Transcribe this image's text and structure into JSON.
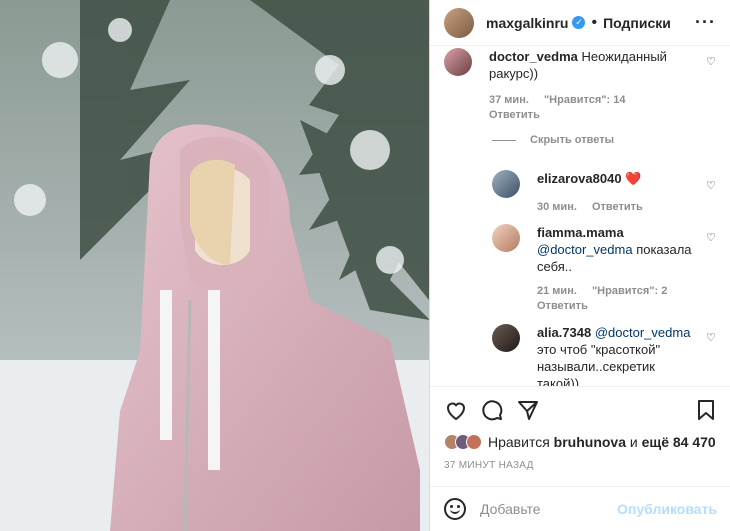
{
  "header": {
    "username": "maxgalkinru",
    "verified_icon": "verified-badge-icon",
    "separator": "•",
    "follow_label": "Подписки",
    "more_icon": "more-options-icon"
  },
  "comments": [
    {
      "user": "doctor_vedma",
      "text": "Неожиданный ракурс))",
      "time": "37 мин.",
      "likes": "\"Нравится\": 14",
      "reply": "Ответить"
    },
    {
      "hide_replies": "Скрыть ответы"
    },
    {
      "user": "elizarova8040",
      "text": "❤️",
      "time": "30 мин.",
      "reply": "Ответить"
    },
    {
      "user": "fiamma.mama",
      "mention": "@doctor_vedma",
      "text": " показала себя..",
      "time": "21 мин.",
      "likes": "\"Нравится\": 2",
      "reply": "Ответить"
    },
    {
      "user": "alia.7348",
      "mention": "@doctor_vedma",
      "text": " это чтоб \"красоткой\" называли..секретик такой))"
    }
  ],
  "actions": {
    "like_icon": "heart-icon",
    "comment_icon": "comment-icon",
    "share_icon": "share-icon",
    "save_icon": "bookmark-icon"
  },
  "likes": {
    "prefix": "Нравится ",
    "user": "bruhunova",
    "middle": " и ",
    "count": "ещё 84 470"
  },
  "timestamp": "37 МИНУТ НАЗАД",
  "add_comment": {
    "emoji_icon": "emoji-icon",
    "placeholder": "Добавьте",
    "publish": "Опубликовать"
  },
  "colors": {
    "link": "#00376b",
    "verified": "#3897f0",
    "publish_disabled": "#b2dffc",
    "meta": "#8e8e8e"
  }
}
